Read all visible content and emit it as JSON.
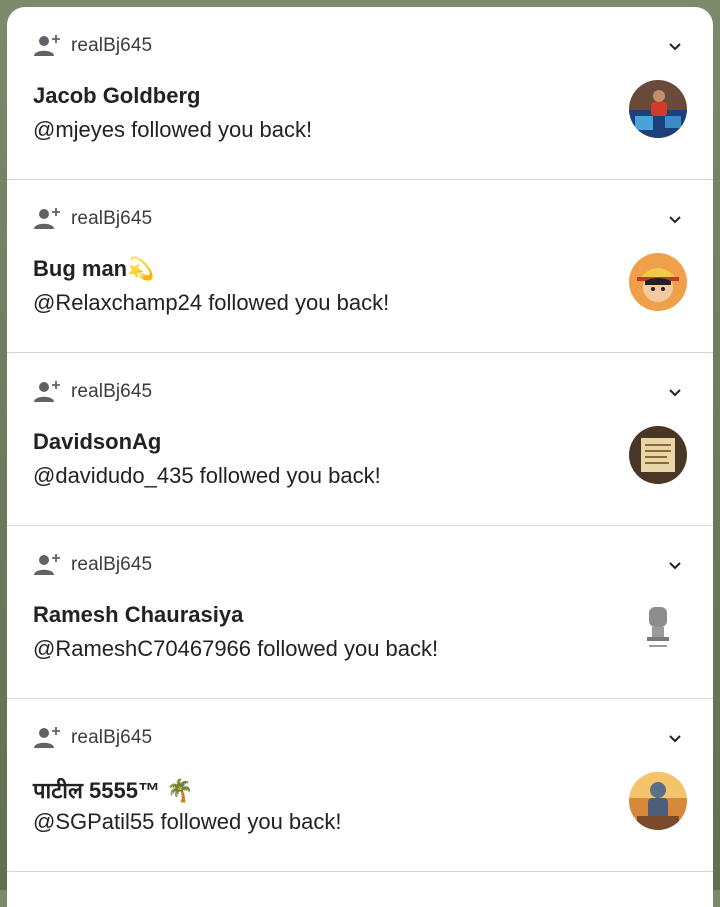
{
  "notifications": [
    {
      "account": "realBj645",
      "name": "Jacob Goldberg",
      "message": "@mjeyes followed you back!",
      "avatar": "person-photo-avatar"
    },
    {
      "account": "realBj645",
      "name": "Bug man💫",
      "message": "@Relaxchamp24 followed you back!",
      "avatar": "anime-character-avatar"
    },
    {
      "account": "realBj645",
      "name": "DavidsonAg",
      "message": "@davidudo_435 followed you back!",
      "avatar": "scroll-document-avatar"
    },
    {
      "account": "realBj645",
      "name": "Ramesh Chaurasiya",
      "message": "@RameshC70467966 followed you back!",
      "avatar": "national-emblem-avatar"
    },
    {
      "account": "realBj645",
      "name": "पाटील 5555™ 🌴",
      "message": "@SGPatil55 followed you back!",
      "avatar": "deity-art-avatar"
    }
  ],
  "icons": {
    "follow": "person-add-icon",
    "expand": "chevron-down-icon"
  }
}
